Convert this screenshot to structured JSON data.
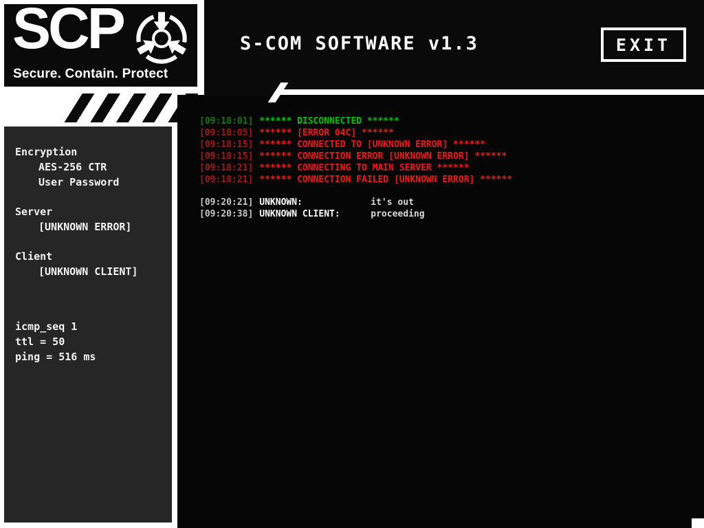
{
  "brand": {
    "wordmark": "SCP",
    "tagline": "Secure. Contain. Protect",
    "emblem_icon": "scp-containment-emblem"
  },
  "header": {
    "title": "S-COM SOFTWARE v1.3",
    "exit_button": "EXIT"
  },
  "sidebar": {
    "sections": [
      {
        "heading": "Encryption",
        "lines": [
          "AES-256 CTR",
          "User Password"
        ]
      },
      {
        "heading": "Server",
        "lines": [
          "[UNKNOWN ERROR]"
        ]
      },
      {
        "heading": "Client",
        "lines": [
          "[UNKNOWN CLIENT]"
        ]
      }
    ],
    "stats": [
      "icmp_seq 1",
      "ttl = 50",
      "ping = 516 ms"
    ]
  },
  "terminal": {
    "system_log": [
      {
        "time": "[09:18:01]",
        "text": "****** DISCONNECTED ******",
        "status": "green"
      },
      {
        "time": "[09:18:05]",
        "text": "****** [ERROR 04C] ******",
        "status": "red"
      },
      {
        "time": "[09:18:15]",
        "text": "****** CONNECTED TO [UNKNOWN ERROR] ******",
        "status": "red"
      },
      {
        "time": "[09:18:15]",
        "text": "****** CONNECTION ERROR [UNKNOWN ERROR] ******",
        "status": "red"
      },
      {
        "time": "[09:18:21]",
        "text": "****** CONNECTING TO MAIN SERVER ******",
        "status": "red"
      },
      {
        "time": "[09:18:21]",
        "text": "****** CONNECTION FAILED [UNKNOWN ERROR] ******",
        "status": "red"
      }
    ],
    "chat_log": [
      {
        "time": "[09:20:21]",
        "sender": "UNKNOWN:",
        "text": "it's out"
      },
      {
        "time": "[09:20:38]",
        "sender": "UNKNOWN CLIENT:",
        "text": "proceeding"
      }
    ]
  },
  "colors": {
    "panel_black": "#0a0a0a",
    "sidebar_gray": "#262626",
    "terminal_black": "#060606",
    "green_time": "#117a11",
    "green_text": "#00c300",
    "red_time": "#aa1616",
    "red_text": "#f01717",
    "chat_time": "#c8c8c8",
    "chat_sender": "#ffffff",
    "chat_text": "#dadada"
  }
}
